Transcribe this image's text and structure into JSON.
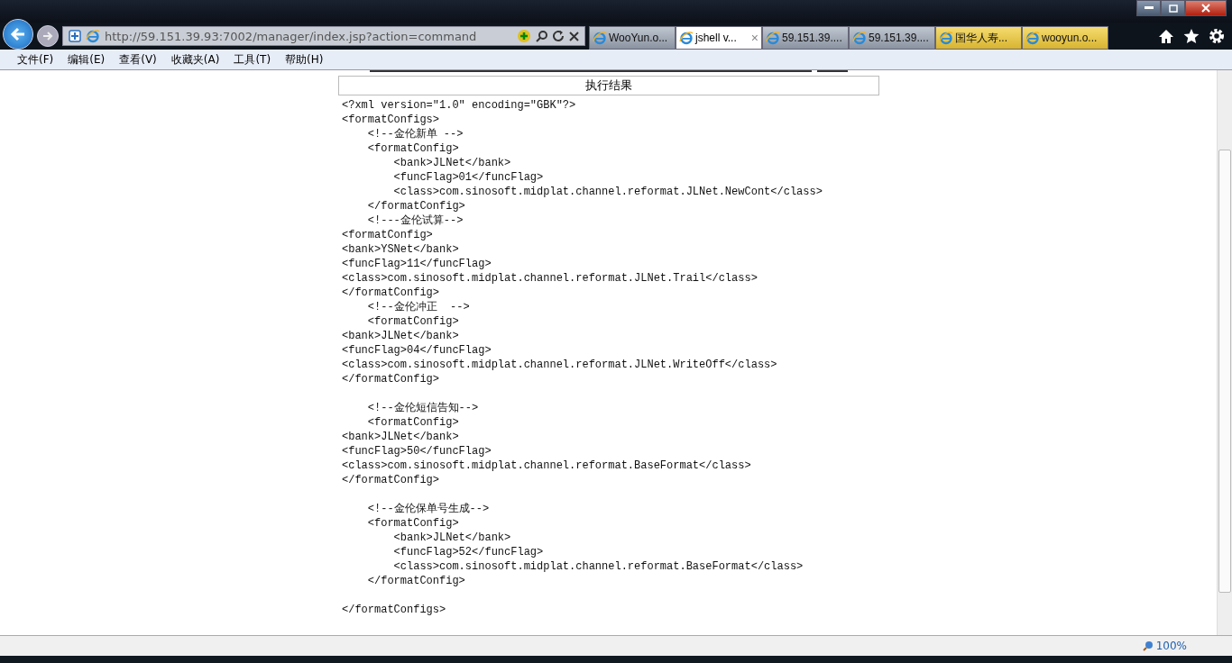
{
  "address_bar": {
    "url": "http://59.151.39.93:7002/manager/index.jsp?action=command"
  },
  "tabs": [
    {
      "title": "WooYun.o...",
      "selected": false,
      "highlighted": false
    },
    {
      "title": "jshell v...",
      "selected": true,
      "highlighted": false,
      "close": "×"
    },
    {
      "title": "59.151.39....",
      "selected": false,
      "highlighted": false
    },
    {
      "title": "59.151.39....",
      "selected": false,
      "highlighted": false
    },
    {
      "title": "国华人寿...",
      "selected": false,
      "highlighted": true
    },
    {
      "title": "wooyun.o...",
      "selected": false,
      "highlighted": true
    }
  ],
  "menu": [
    "文件(F)",
    "编辑(E)",
    "查看(V)",
    "收藏夹(A)",
    "工具(T)",
    "帮助(H)"
  ],
  "result_table": {
    "header": "执行结果"
  },
  "result_text": "<?xml version=\"1.0\" encoding=\"GBK\"?>\n<formatConfigs>\n    <!--金伦新单 -->\n    <formatConfig>\n        <bank>JLNet</bank>\n        <funcFlag>01</funcFlag>\n        <class>com.sinosoft.midplat.channel.reformat.JLNet.NewCont</class>\n    </formatConfig>\n    <!---金伦试算-->\n<formatConfig>\n<bank>YSNet</bank>\n<funcFlag>11</funcFlag>\n<class>com.sinosoft.midplat.channel.reformat.JLNet.Trail</class>\n</formatConfig>\n    <!--金伦冲正  -->\n    <formatConfig>\n<bank>JLNet</bank>\n<funcFlag>04</funcFlag>\n<class>com.sinosoft.midplat.channel.reformat.JLNet.WriteOff</class>\n</formatConfig>\n\n    <!--金伦短信告知-->\n    <formatConfig>\n<bank>JLNet</bank>\n<funcFlag>50</funcFlag>\n<class>com.sinosoft.midplat.channel.reformat.BaseFormat</class>\n</formatConfig>\n\n    <!--金伦保单号生成-->\n    <formatConfig>\n        <bank>JLNet</bank>\n        <funcFlag>52</funcFlag>\n        <class>com.sinosoft.midplat.channel.reformat.BaseFormat</class>\n    </formatConfig>\n\n</formatConfigs>",
  "status_bar": {
    "zoom": "100%"
  }
}
